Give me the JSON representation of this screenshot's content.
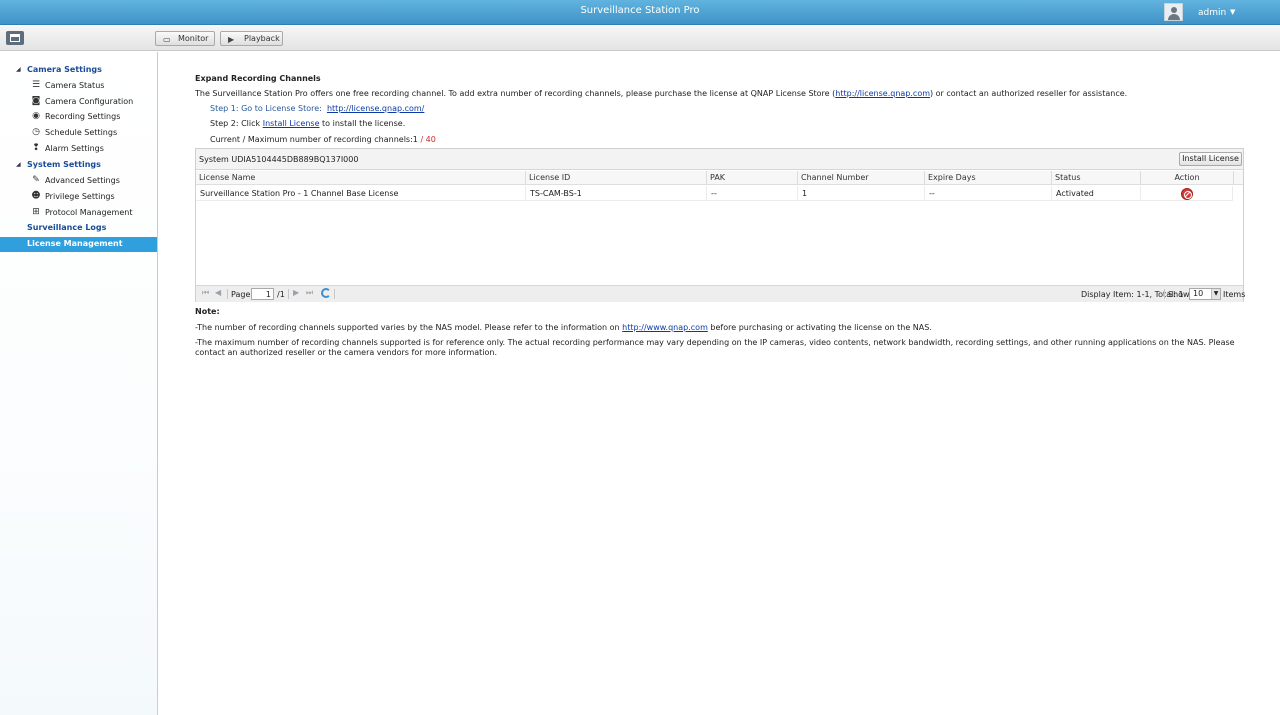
{
  "app": {
    "title": "Surveillance Station Pro",
    "user": "admin"
  },
  "toolbar": {
    "monitor_label": "Monitor",
    "playback_label": "Playback"
  },
  "sidebar": {
    "camera_settings": "Camera Settings",
    "camera_items": [
      "Camera Status",
      "Camera Configuration",
      "Recording Settings",
      "Schedule Settings",
      "Alarm Settings"
    ],
    "system_settings": "System Settings",
    "system_items": [
      "Advanced Settings",
      "Privilege Settings",
      "Protocol Management"
    ],
    "surveillance_logs": "Surveillance Logs",
    "license_management": "License Management"
  },
  "main": {
    "section_title": "Expand Recording Channels",
    "intro_pre": "The Surveillance Station Pro offers one free recording channel. To add extra number of recording channels, please purchase the license at QNAP License Store (",
    "intro_link": "http://license.qnap.com",
    "intro_post": ") or contact an authorized reseller for assistance.",
    "step1_label": "Step 1: Go to License Store:",
    "step1_link": "http://license.qnap.com/",
    "step2_pre": "Step 2: Click",
    "step2_link": "Install License",
    "step2_post": "to install the license.",
    "channels_label": "Current / Maximum number of recording channels:1",
    "channels_max": "/ 40"
  },
  "grid": {
    "system_id": "System UDIA5104445DB889BQ137I000",
    "install_button": "Install License",
    "columns": [
      "License Name",
      "License ID",
      "PAK",
      "Channel Number",
      "Expire Days",
      "Status",
      "Action"
    ],
    "rows": [
      {
        "name": "Surveillance Station Pro - 1 Channel Base License",
        "id": "TS-CAM-BS-1",
        "pak": "--",
        "channels": "1",
        "expire": "--",
        "status": "Activated"
      }
    ]
  },
  "pager": {
    "page_label": "Page",
    "page_value": "1",
    "page_total": "/1",
    "display_info": "Display Item: 1-1, Total: 1",
    "show_label": "Show",
    "show_value": "10",
    "items_label": "Items"
  },
  "notes": {
    "title": "Note:",
    "note1_pre": "-The number of recording channels supported varies by the NAS model. Please refer to the information on ",
    "note1_link": "http://www.qnap.com",
    "note1_post": " before purchasing or activating the license on the NAS.",
    "note2": "-The maximum number of recording channels supported is for reference only. The actual recording performance may vary depending on the IP cameras, video contents, network bandwidth, recording settings, and other running applications on the NAS. Please contact an authorized reseller or the camera vendors for more information."
  },
  "colors": {
    "titlebar": "#3f93c6",
    "active_nav": "#2f9fdd",
    "link": "#0b3aa6",
    "max_channels": "#cc2a2a"
  },
  "icons": {
    "camera_items": [
      "list-icon",
      "camera-icon",
      "record-icon",
      "clock-icon",
      "alarm-icon"
    ],
    "system_items": [
      "wrench-icon",
      "user-icon",
      "network-icon"
    ],
    "action": "remove-icon"
  }
}
